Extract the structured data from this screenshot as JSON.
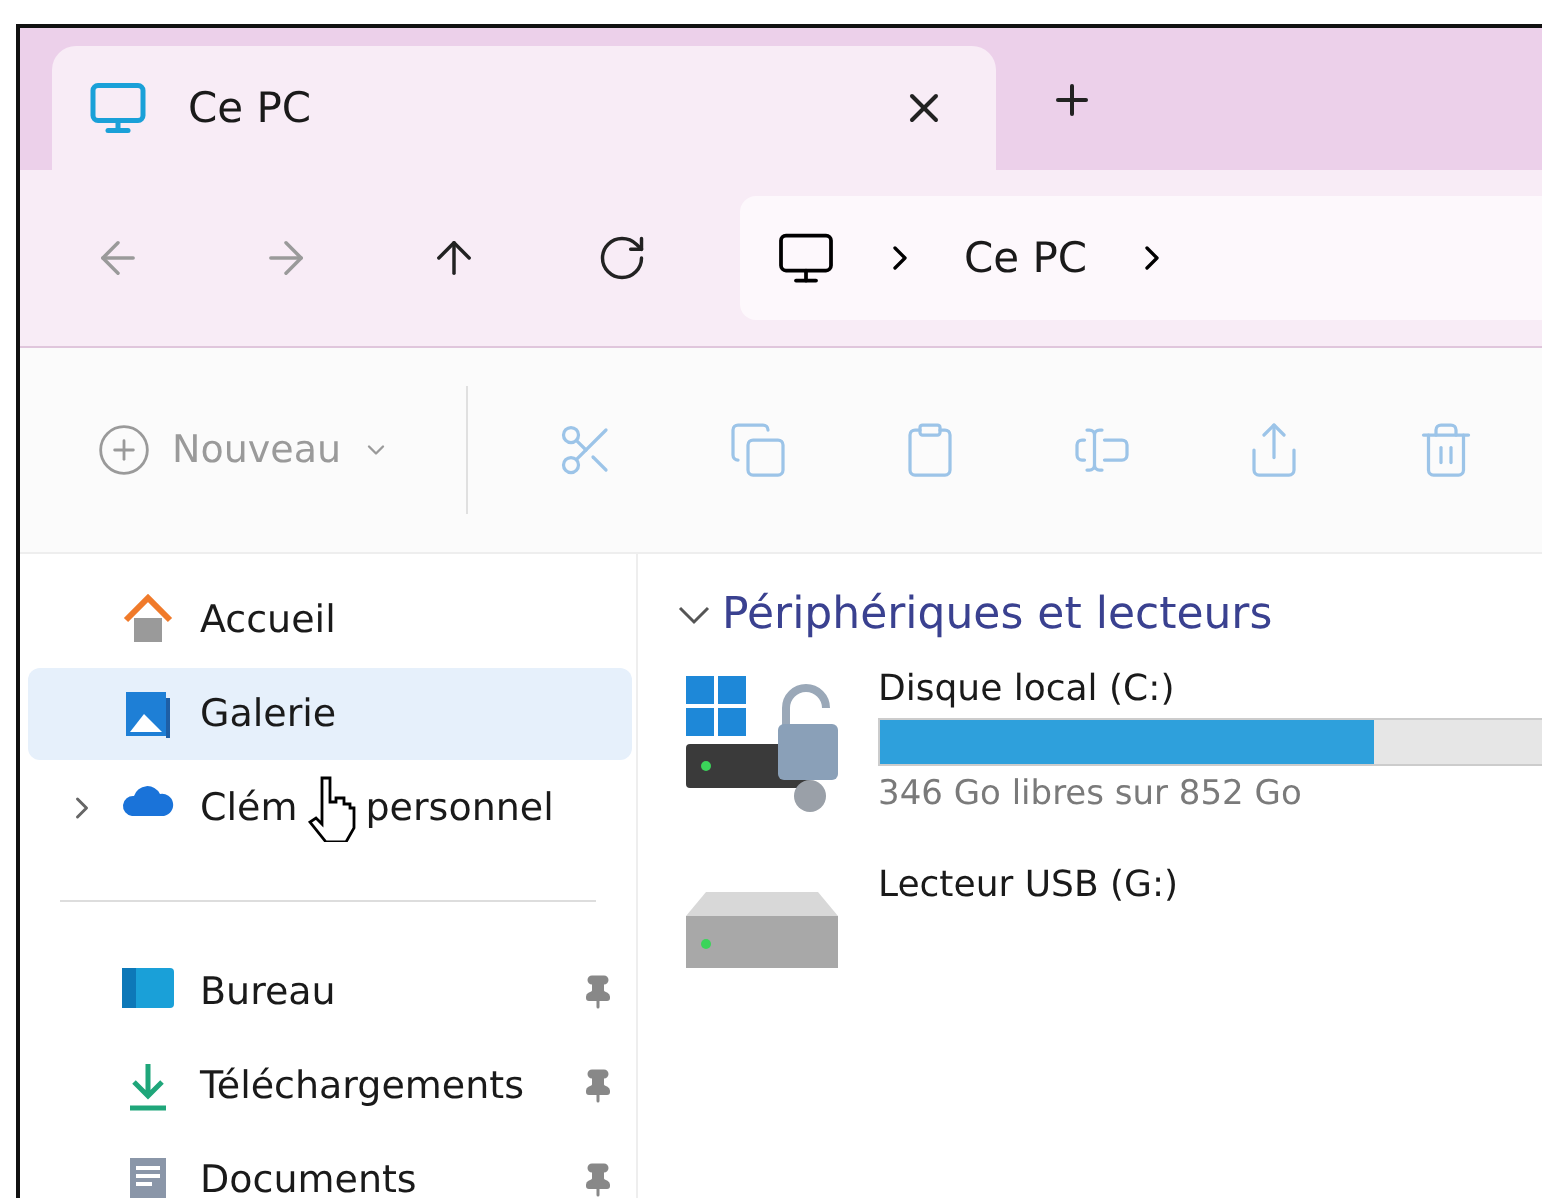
{
  "tabs": [
    {
      "label": "Ce PC",
      "selected": true
    }
  ],
  "nav": {
    "buttons": [
      {
        "kind": "back",
        "disabled": true
      },
      {
        "kind": "forward",
        "disabled": true
      },
      {
        "kind": "up",
        "disabled": false
      },
      {
        "kind": "refresh",
        "disabled": false
      }
    ]
  },
  "address": {
    "crumbs": [
      "Ce PC"
    ]
  },
  "toolbar": {
    "new_label": "Nouveau",
    "actions": [
      {
        "kind": "cut",
        "disabled": true
      },
      {
        "kind": "copy",
        "disabled": true
      },
      {
        "kind": "paste",
        "disabled": true
      },
      {
        "kind": "rename",
        "disabled": true
      },
      {
        "kind": "share",
        "disabled": true
      },
      {
        "kind": "delete",
        "disabled": true
      }
    ]
  },
  "sidebar": {
    "groups": [
      [
        {
          "kind": "home",
          "label": "Accueil",
          "selected": false
        },
        {
          "kind": "gallery",
          "label": "Galerie",
          "selected": true
        },
        {
          "kind": "cloud",
          "label": "Clém",
          "label_end": "personnel",
          "selected": false,
          "expanded": false
        }
      ],
      [
        {
          "kind": "desktop",
          "label": "Bureau",
          "selected": false,
          "pinned": true
        },
        {
          "kind": "downloads",
          "label": "Téléchargements",
          "selected": false,
          "pinned": true
        },
        {
          "kind": "documents",
          "label": "Documents",
          "selected": false,
          "pinned": true
        }
      ]
    ]
  },
  "section": {
    "title": "Périphériques et lecteurs",
    "expanded": true,
    "drives": [
      {
        "kind": "system",
        "name": "Disque local (C:)",
        "level": 0.59,
        "free_text": "346 Go libres sur 852 Go"
      },
      {
        "kind": "usb",
        "name": "Lecteur USB (G:)"
      }
    ]
  }
}
